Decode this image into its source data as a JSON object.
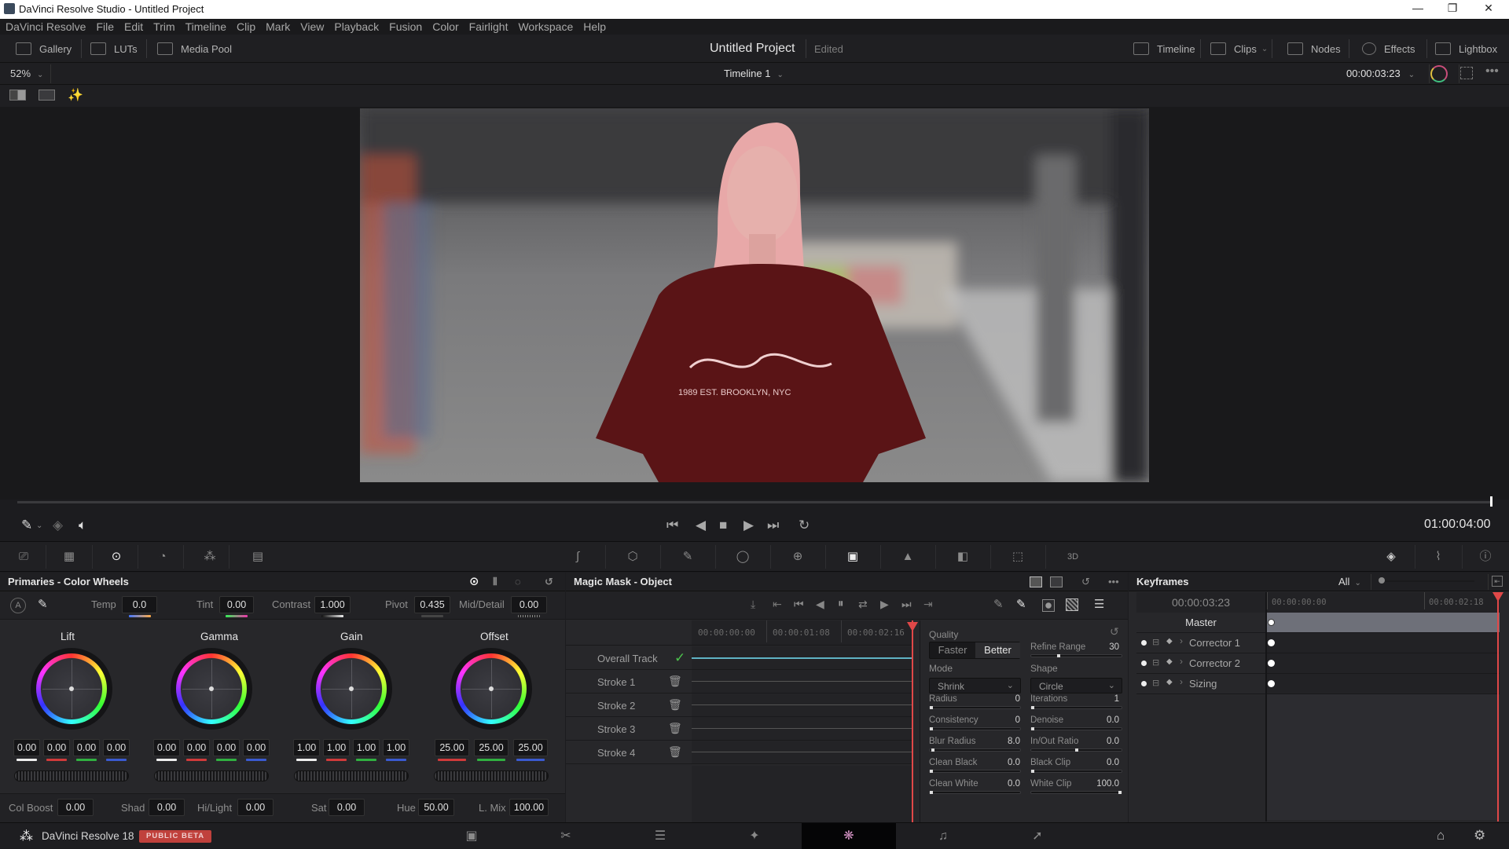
{
  "window": {
    "title": "DaVinci Resolve Studio - Untitled Project",
    "controls": [
      "—",
      "❐",
      "✕"
    ]
  },
  "menu": [
    "DaVinci Resolve",
    "File",
    "Edit",
    "Trim",
    "Timeline",
    "Clip",
    "Mark",
    "View",
    "Playback",
    "Fusion",
    "Color",
    "Fairlight",
    "Workspace",
    "Help"
  ],
  "toolbar": {
    "left": [
      {
        "label": "Gallery",
        "icon": "gallery-icon"
      },
      {
        "label": "LUTs",
        "icon": "luts-icon"
      },
      {
        "label": "Media Pool",
        "icon": "media-pool-icon"
      }
    ],
    "project_title": "Untitled Project",
    "project_status": "Edited",
    "right": [
      {
        "label": "Timeline",
        "icon": "timeline-icon"
      },
      {
        "label": "Clips",
        "icon": "clips-icon"
      },
      {
        "label": "Nodes",
        "icon": "nodes-icon"
      },
      {
        "label": "Effects",
        "icon": "effects-icon"
      },
      {
        "label": "Lightbox",
        "icon": "lightbox-icon"
      }
    ]
  },
  "viewer": {
    "zoom": "52%",
    "timeline_name": "Timeline 1",
    "timecode_top": "00:00:03:23",
    "timecode_main": "01:00:04:00",
    "shirt_text": "1989 EST. BROOKLYN, NYC",
    "mask_tint": "#8b1a1a"
  },
  "primaries": {
    "title": "Primaries - Color Wheels",
    "top_params": [
      {
        "label": "Temp",
        "value": "0.0"
      },
      {
        "label": "Tint",
        "value": "0.00"
      },
      {
        "label": "Contrast",
        "value": "1.000"
      },
      {
        "label": "Pivot",
        "value": "0.435"
      },
      {
        "label": "Mid/Detail",
        "value": "0.00"
      }
    ],
    "wheels": [
      {
        "name": "Lift",
        "values": [
          "0.00",
          "0.00",
          "0.00",
          "0.00"
        ]
      },
      {
        "name": "Gamma",
        "values": [
          "0.00",
          "0.00",
          "0.00",
          "0.00"
        ]
      },
      {
        "name": "Gain",
        "values": [
          "1.00",
          "1.00",
          "1.00",
          "1.00"
        ]
      },
      {
        "name": "Offset",
        "values": [
          "25.00",
          "25.00",
          "25.00"
        ]
      }
    ],
    "bottom_params": [
      {
        "label": "Col Boost",
        "value": "0.00"
      },
      {
        "label": "Shad",
        "value": "0.00"
      },
      {
        "label": "Hi/Light",
        "value": "0.00"
      },
      {
        "label": "Sat",
        "value": "0.00"
      },
      {
        "label": "Hue",
        "value": "50.00"
      },
      {
        "label": "L. Mix",
        "value": "100.00"
      }
    ]
  },
  "magic_mask": {
    "title": "Magic Mask - Object",
    "ruler": [
      "00:00:00:00",
      "00:00:01:08",
      "00:00:02:16"
    ],
    "tracks": [
      {
        "name": "Overall Track",
        "status": "✓"
      },
      {
        "name": "Stroke 1"
      },
      {
        "name": "Stroke 2"
      },
      {
        "name": "Stroke 3"
      },
      {
        "name": "Stroke 4"
      }
    ],
    "quality_label": "Quality",
    "quality_options": [
      "Faster",
      "Better"
    ],
    "quality_selected": "Better",
    "mode_label": "Mode",
    "mode_value": "Shrink",
    "shape_label": "Shape",
    "shape_value": "Circle",
    "settings_left": [
      {
        "label": "Radius",
        "value": "0",
        "fraction": 0.0
      },
      {
        "label": "Consistency",
        "value": "0",
        "fraction": 0.0
      },
      {
        "label": "Blur Radius",
        "value": "8.0",
        "fraction": 0.02
      },
      {
        "label": "Clean Black",
        "value": "0.0",
        "fraction": 0.0
      },
      {
        "label": "Clean White",
        "value": "0.0",
        "fraction": 0.0
      }
    ],
    "settings_right": [
      {
        "label": "Refine Range",
        "value": "30",
        "fraction": 0.3
      },
      {
        "label": "Iterations",
        "value": "1",
        "fraction": 0.0
      },
      {
        "label": "Denoise",
        "value": "0.0",
        "fraction": 0.0
      },
      {
        "label": "In/Out Ratio",
        "value": "0.0",
        "fraction": 0.5
      },
      {
        "label": "Black Clip",
        "value": "0.0",
        "fraction": 0.0
      },
      {
        "label": "White Clip",
        "value": "100.0",
        "fraction": 1.0
      }
    ]
  },
  "keyframes": {
    "title": "Keyframes",
    "filter": "All",
    "timecode": "00:00:03:23",
    "ruler": [
      "00:00:00:00",
      "00:00:02:18"
    ],
    "rows": [
      "Master",
      "Corrector 1",
      "Corrector 2",
      "Sizing"
    ]
  },
  "bottom": {
    "app_name": "DaVinci Resolve 18",
    "badge": "PUBLIC BETA",
    "badge_color": "#c0413c",
    "pages": [
      {
        "name": "media",
        "glyph": "▣"
      },
      {
        "name": "cut",
        "glyph": "✂"
      },
      {
        "name": "edit",
        "glyph": "☰"
      },
      {
        "name": "fusion",
        "glyph": "✦"
      },
      {
        "name": "color",
        "glyph": "❋"
      },
      {
        "name": "fairlight",
        "glyph": "♫"
      },
      {
        "name": "deliver",
        "glyph": "➚"
      }
    ],
    "active_page": "color"
  }
}
